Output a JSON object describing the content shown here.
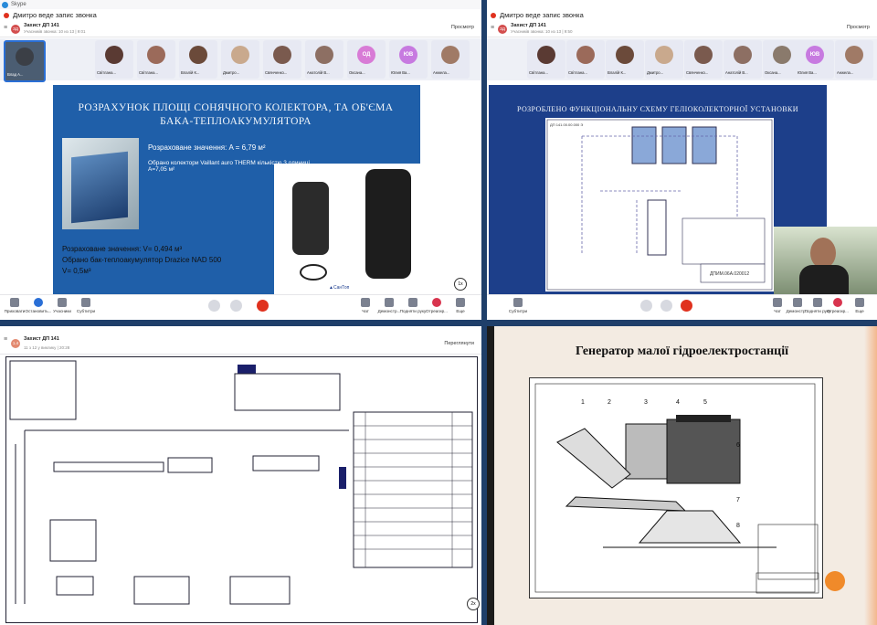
{
  "app": {
    "title": "Skype",
    "recording": "Дмитро веде запис звонка"
  },
  "meeting": {
    "name": "Захист ДП 141",
    "subtitle": "Учасників звонка: 10 из 13 | 9:01",
    "subtitle2": "Учасників звонка: 10 из 13 | 9:50",
    "preview": "Просмотр"
  },
  "participants": [
    "Влад А...",
    "Світлана...",
    "Світлана...",
    "Влалій К...",
    "Дмитро...",
    "Свянченко...",
    "Анатолій В...",
    "Оксана...",
    "Юлия Ва...",
    "Анжела..."
  ],
  "initials": {
    "od": "ОД",
    "yv": "ЮВ"
  },
  "toolbar": {
    "leave": "Приховати",
    "record": "Остановить...",
    "people": "Учасники",
    "subtitles": "Субтитри",
    "chat": "Чат",
    "demo": "Демонстр...",
    "hand": "Подняти руку",
    "react": "Отреагир...",
    "more": "Еще"
  },
  "slide1": {
    "title": "РОЗРАХУНОК ПЛОЩІ СОНЯЧНОГО КОЛЕКТОРА, ТА ОБ'ЄМА БАКА-ТЕПЛОАКУМУЛЯТОРА",
    "area": "Розраховане значення: A = 6,79 м²",
    "chosen": "Обрано колектори Vaillant auro THERM кількістю 3 одиниці, A=7,05 м²",
    "volume": "Розраховане значення: V= 0,494 м³",
    "tank": "Обрано бак-теплоакумулятор Drazice NAD 500",
    "v_final": "V= 0,5м³",
    "brand": "▲СанТоп",
    "page": "1x"
  },
  "slide2": {
    "title": "РОЗРОБЛЕНО ФУНКЦІОНАЛЬНУ СХЕМУ ГЕЛІОКОЛЕКТОРНОЇ УСТАНОВКИ",
    "stamp": "ДП 141.00.00.000 Э",
    "code": "ДПИМ.06A.020012"
  },
  "q3": {
    "name": "Захист ДП 141",
    "sub": "11 з 12 у виклику | 20:28",
    "btn": "Переглянути",
    "page": "2x"
  },
  "q4": {
    "title": "Генератор малої гідроелектростанції",
    "labels": [
      "1",
      "2",
      "3",
      "4",
      "5",
      "6",
      "7",
      "8"
    ]
  },
  "colors": {
    "slide_blue": "#1f5fa9",
    "accent": "#2a6fd6",
    "end_call": "#e0311e",
    "orange_dot": "#f08a2a"
  }
}
